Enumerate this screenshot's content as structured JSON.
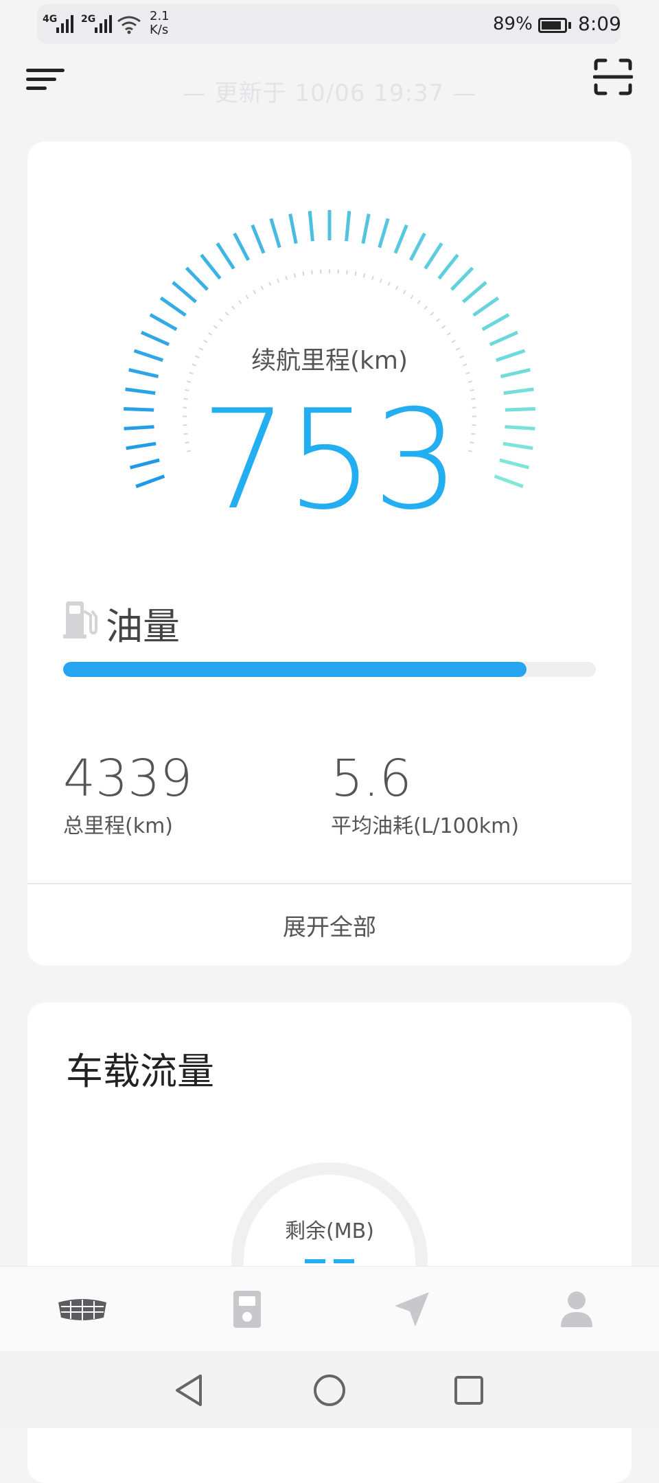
{
  "status_bar": {
    "network1": "4G",
    "network2": "2G",
    "speed_value": "2.1",
    "speed_unit": "K/s",
    "battery_percent": "89%",
    "battery_level": 0.89,
    "time": "8:09"
  },
  "header": {
    "update_text": "— 更新于 10/06 19:37 —",
    "menu_icon": "menu-icon",
    "scan_icon": "scan-icon"
  },
  "main_card": {
    "range_label": "续航里程(km)",
    "range_value": "753",
    "fuel_label": "油量",
    "fuel_level": 0.87,
    "total_mileage_value": "4339",
    "total_mileage_label": "总里程(km)",
    "avg_consumption_value": "5.6",
    "avg_consumption_label": "平均油耗(L/100km)",
    "expand_label": "展开全部"
  },
  "data_card": {
    "title": "车载流量",
    "remaining_label": "剩余(MB)",
    "remaining_value": "--"
  },
  "bottom_nav": {
    "items": [
      {
        "icon": "car-icon",
        "active": true
      },
      {
        "icon": "car-key-icon",
        "active": false
      },
      {
        "icon": "navigation-icon",
        "active": false
      },
      {
        "icon": "profile-icon",
        "active": false
      }
    ]
  },
  "system_nav": {
    "icons": [
      "back-icon",
      "home-icon",
      "recent-apps-icon"
    ]
  },
  "colors": {
    "accent_blue": "#22aef0",
    "gauge_start": "#1e98e8",
    "gauge_end": "#7fe8d8",
    "fuel_bar": "#27a4f0",
    "icon_gray": "#c8c8cc"
  }
}
